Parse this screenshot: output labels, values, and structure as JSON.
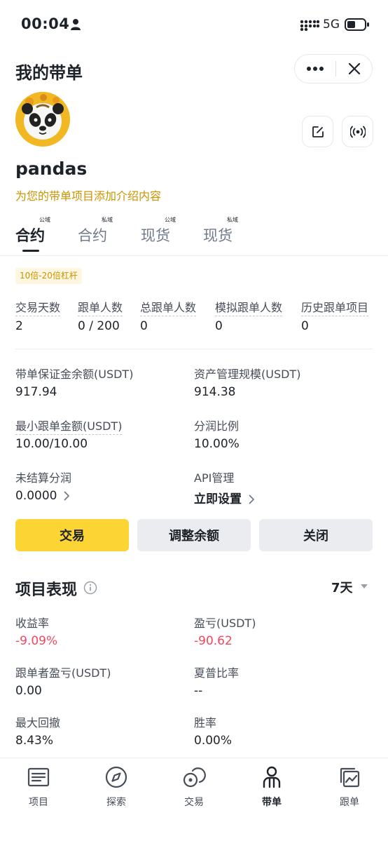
{
  "status": {
    "time": "00:04",
    "network": "5G"
  },
  "header": {
    "title": "我的带单"
  },
  "profile": {
    "name": "pandas",
    "intro_link": "为您的带单项目添加介绍内容"
  },
  "tabs": [
    {
      "label": "合约",
      "sup": "公域",
      "active": true
    },
    {
      "label": "合约",
      "sup": "私域",
      "active": false
    },
    {
      "label": "现货",
      "sup": "公域",
      "active": false
    },
    {
      "label": "现货",
      "sup": "私域",
      "active": false
    }
  ],
  "leverage_badge": "10倍-20倍杠杆",
  "stats": [
    {
      "label": "交易天数",
      "value": "2"
    },
    {
      "label": "跟单人数",
      "value": "0 / 200"
    },
    {
      "label": "总跟单人数",
      "value": "0"
    },
    {
      "label": "模拟跟单人数",
      "value": "0"
    },
    {
      "label": "历史跟单项目",
      "value": "0"
    }
  ],
  "details": {
    "margin_balance": {
      "label": "带单保证金余额(USDT)",
      "value": "917.94"
    },
    "aum": {
      "label": "资产管理规模(USDT)",
      "value": "914.38"
    },
    "min_copy": {
      "label": "最小跟单金额(USDT)",
      "value": "10.00/10.00"
    },
    "profit_share": {
      "label": "分润比例",
      "value": "10.00%"
    },
    "unsettled": {
      "label": "未结算分润",
      "value": "0.0000"
    },
    "api": {
      "label": "API管理",
      "value": "立即设置"
    }
  },
  "actions": {
    "trade": "交易",
    "adjust": "调整余额",
    "close": "关闭"
  },
  "performance": {
    "title": "项目表现",
    "period": "7天",
    "roi": {
      "label": "收益率",
      "value": "-9.09%"
    },
    "pnl": {
      "label": "盈亏(USDT)",
      "value": "-90.62"
    },
    "copier_pnl": {
      "label": "跟单者盈亏(USDT)",
      "value": "0.00"
    },
    "sharpe": {
      "label": "夏普比率",
      "value": "--"
    },
    "max_drawdown": {
      "label": "最大回撤",
      "value": "8.43%"
    },
    "win_rate": {
      "label": "胜率",
      "value": "0.00%"
    }
  },
  "bottom_nav": [
    {
      "label": "项目",
      "icon": "list-icon"
    },
    {
      "label": "探索",
      "icon": "compass-icon"
    },
    {
      "label": "交易",
      "icon": "trade-coins-icon"
    },
    {
      "label": "带单",
      "icon": "lead-person-icon",
      "active": true
    },
    {
      "label": "跟单",
      "icon": "copy-chart-icon"
    }
  ],
  "colors": {
    "accent": "#fcd535",
    "link": "#c99400",
    "negative": "#f6465d",
    "text": "#1e2329"
  }
}
